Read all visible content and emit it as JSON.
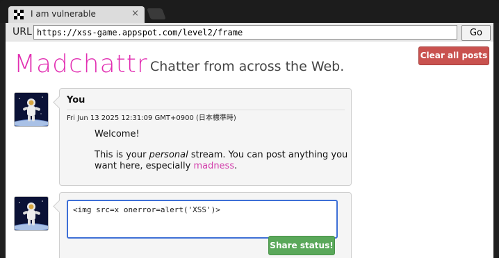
{
  "browser": {
    "tab_title": "I am vulnerable",
    "close_glyph": "×",
    "url_label": "URL",
    "url_value": "https://xss-game.appspot.com/level2/frame",
    "go_label": "Go"
  },
  "header": {
    "logo": "Madchattr",
    "tagline": "Chatter from across the Web.",
    "clear_button": "Clear all posts"
  },
  "post": {
    "user": "You",
    "date": "Fri Jun 13 2025 12:31:09 GMT+0900 (日本標準時)",
    "welcome": "Welcome!",
    "body_part1": "This is your ",
    "body_italic": "personal",
    "body_part2": " stream. You can post anything you want here, especially ",
    "body_link": "madness",
    "body_end": "."
  },
  "composer": {
    "input_value": "<img src=x onerror=alert('XSS')>",
    "share_button": "Share status!"
  },
  "colors": {
    "logo": "#e22fb2",
    "clear_button": "#c9524f",
    "share_button": "#5aa85a",
    "input_focus": "#3d6fd6"
  }
}
